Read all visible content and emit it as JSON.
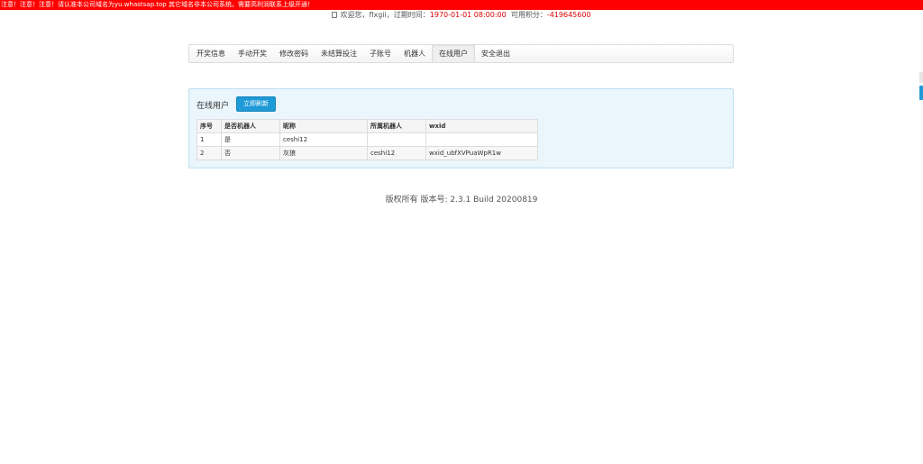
{
  "alert": {
    "text": "注意！注意！注意！请认准本公司域名为yu.whastsap.top 其它域名非本公司系统。需要高利润联系上级开通！"
  },
  "welcome": {
    "prefix": "欢迎您，flxgii，过期时间：",
    "expire": "1970-01-01 08:00:00",
    "points_label": "可用积分：",
    "points": "-419645600"
  },
  "nav": {
    "items": [
      {
        "label": "开奖信息"
      },
      {
        "label": "手动开奖"
      },
      {
        "label": "修改密码"
      },
      {
        "label": "未结算投注"
      },
      {
        "label": "子账号"
      },
      {
        "label": "机器人"
      },
      {
        "label": "在线用户",
        "active": true
      },
      {
        "label": "安全退出"
      }
    ]
  },
  "panel": {
    "title": "在线用户",
    "refresh_label": "立即刷新"
  },
  "table": {
    "headers": [
      "序号",
      "是否机器人",
      "昵称",
      "所属机器人",
      "wxid"
    ],
    "rows": [
      [
        "1",
        "是",
        "ceshi12",
        "",
        ""
      ],
      [
        "2",
        "否",
        "灰狼",
        "ceshi12",
        "wxid_ubfXVPuaWpR1w"
      ]
    ]
  },
  "footer": {
    "text": "版权所有 版本号: 2.3.1 Build 20200819"
  },
  "colors": {
    "alert_bg": "#ff0000",
    "accent": "#1e9ad6",
    "panel_bg": "#eaf5fc",
    "highlight_red": "#e00000"
  }
}
